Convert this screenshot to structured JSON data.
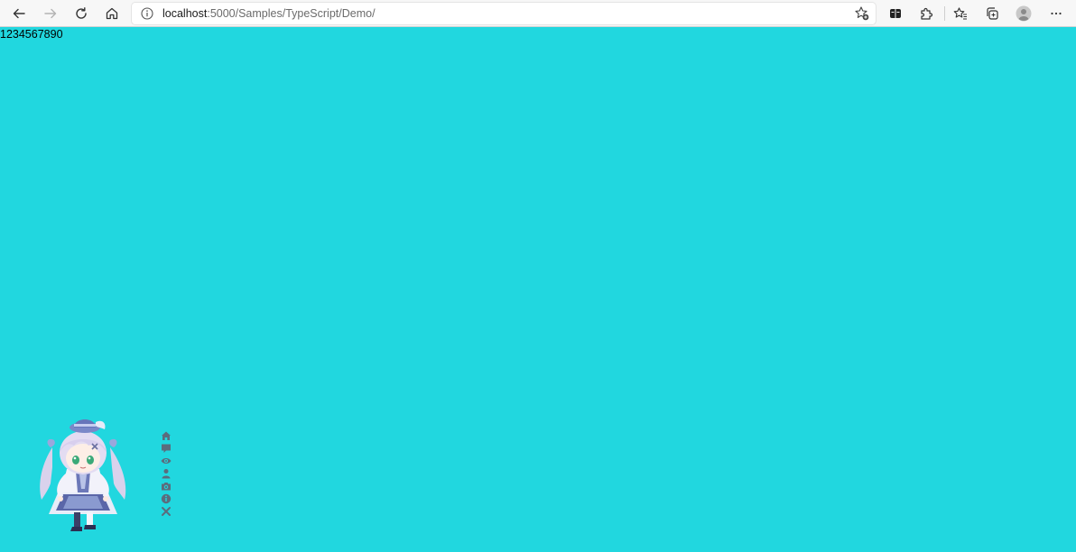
{
  "browser": {
    "url_host": "localhost",
    "url_rest": ":5000/Samples/TypeScript/Demo/",
    "toolbar_icons": [
      "back-icon",
      "forward-icon",
      "refresh-icon",
      "home-icon",
      "info-icon",
      "favorite-add-icon",
      "immersive-reader-icon",
      "extensions-icon",
      "favorites-icon",
      "collections-icon",
      "profile-icon",
      "more-icon"
    ]
  },
  "page": {
    "text": "1234567890",
    "background": "#21d7df"
  },
  "waifu": {
    "tools": [
      "home-icon",
      "comment-icon",
      "eye-icon",
      "user-icon",
      "camera-icon",
      "info-icon",
      "close-icon"
    ],
    "tool_color": "#5b6c7d"
  }
}
